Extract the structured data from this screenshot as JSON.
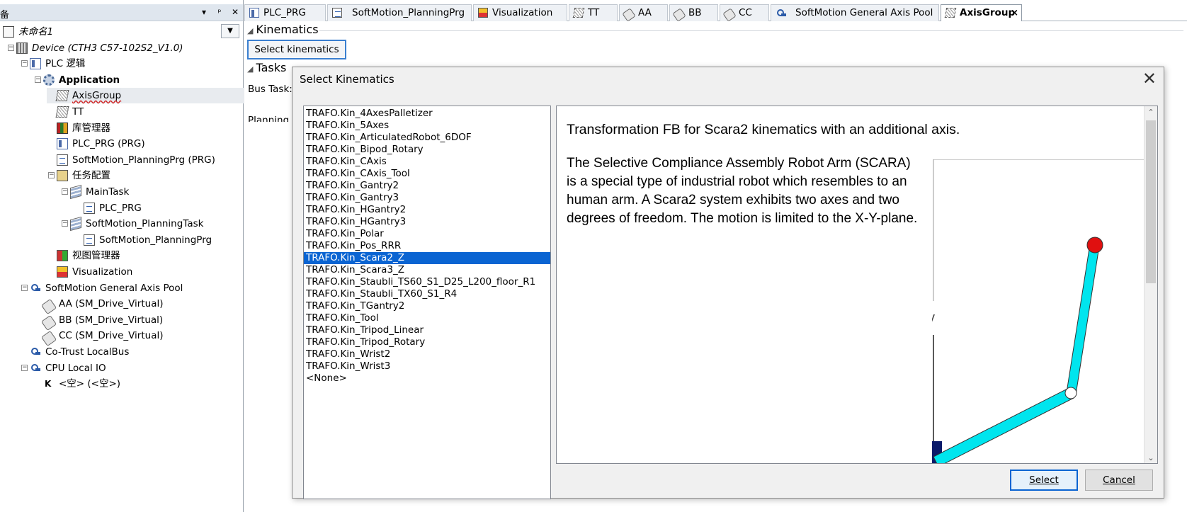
{
  "left_panel": {
    "header_title": "备",
    "header_controls": [
      "▾",
      "ᵖ",
      "✕"
    ],
    "project_selector": "",
    "tree": [
      {
        "label": "未命名1",
        "icon": "project-icon",
        "indent": 0,
        "expander": "",
        "style": "italic"
      },
      {
        "label": "Device (CTH3 C57-102S2_V1.0)",
        "icon": "device-icon",
        "indent": 1,
        "expander": "−",
        "style": "italic"
      },
      {
        "label": "PLC 逻辑",
        "icon": "plc-logic-icon",
        "indent": 2,
        "expander": "−",
        "style": ""
      },
      {
        "label": "Application",
        "icon": "application-gear-icon",
        "indent": 3,
        "expander": "−",
        "style": "bold"
      },
      {
        "label": "AxisGroup",
        "icon": "axis-group-icon",
        "indent": 4,
        "expander": "",
        "style": "squiggle",
        "selected": true
      },
      {
        "label": "TT",
        "icon": "axis-group-icon",
        "indent": 4,
        "expander": "",
        "style": ""
      },
      {
        "label": "库管理器",
        "icon": "library-manager-icon",
        "indent": 4,
        "expander": "",
        "style": ""
      },
      {
        "label": "PLC_PRG (PRG)",
        "icon": "program-icon",
        "indent": 4,
        "expander": "",
        "style": ""
      },
      {
        "label": "SoftMotion_PlanningPrg (PRG)",
        "icon": "program-doc-icon",
        "indent": 4,
        "expander": "",
        "style": ""
      },
      {
        "label": "任务配置",
        "icon": "task-config-icon",
        "indent": 4,
        "expander": "−",
        "style": ""
      },
      {
        "label": "MainTask",
        "icon": "task-icon",
        "indent": 5,
        "expander": "−",
        "style": ""
      },
      {
        "label": "PLC_PRG",
        "icon": "program-call-icon",
        "indent": 6,
        "expander": "",
        "style": ""
      },
      {
        "label": "SoftMotion_PlanningTask",
        "icon": "task-icon",
        "indent": 5,
        "expander": "−",
        "style": ""
      },
      {
        "label": "SoftMotion_PlanningPrg",
        "icon": "program-call-icon",
        "indent": 6,
        "expander": "",
        "style": ""
      },
      {
        "label": "视图管理器",
        "icon": "visualization-manager-icon",
        "indent": 4,
        "expander": "",
        "style": ""
      },
      {
        "label": "Visualization",
        "icon": "visualization-icon",
        "indent": 4,
        "expander": "",
        "style": ""
      },
      {
        "label": "SoftMotion General Axis Pool",
        "icon": "axis-pool-icon",
        "indent": 2,
        "expander": "−",
        "style": ""
      },
      {
        "label": "AA (SM_Drive_Virtual)",
        "icon": "virtual-drive-icon",
        "indent": 3,
        "expander": "",
        "style": ""
      },
      {
        "label": "BB (SM_Drive_Virtual)",
        "icon": "virtual-drive-icon",
        "indent": 3,
        "expander": "",
        "style": ""
      },
      {
        "label": "CC (SM_Drive_Virtual)",
        "icon": "virtual-drive-icon",
        "indent": 3,
        "expander": "",
        "style": ""
      },
      {
        "label": "Co-Trust LocalBus",
        "icon": "bus-icon",
        "indent": 2,
        "expander": "",
        "style": ""
      },
      {
        "label": "CPU Local IO",
        "icon": "bus-icon",
        "indent": 2,
        "expander": "−",
        "style": ""
      },
      {
        "label": "<空> (<空>)",
        "icon": "empty-slot-icon",
        "indent": 3,
        "expander": "",
        "style": ""
      }
    ]
  },
  "tabs": [
    {
      "label": "PLC_PRG",
      "icon": "program-icon",
      "active": false
    },
    {
      "label": "SoftMotion_PlanningPrg",
      "icon": "program-doc-icon",
      "active": false
    },
    {
      "label": "Visualization",
      "icon": "visualization-icon",
      "active": false
    },
    {
      "label": "TT",
      "icon": "axis-group-icon",
      "active": false
    },
    {
      "label": "AA",
      "icon": "virtual-drive-icon",
      "active": false
    },
    {
      "label": "BB",
      "icon": "virtual-drive-icon",
      "active": false
    },
    {
      "label": "CC",
      "icon": "virtual-drive-icon",
      "active": false
    },
    {
      "label": "SoftMotion General Axis Pool",
      "icon": "axis-pool-icon",
      "active": false
    },
    {
      "label": "AxisGroup",
      "icon": "axis-group-icon",
      "active": true,
      "close": "×"
    }
  ],
  "editor": {
    "kinematics_section": "Kinematics",
    "select_kinematics_button": "Select kinematics",
    "tasks_section": "Tasks",
    "bus_task_label": "Bus Task:",
    "planning_task_label": "Planning T"
  },
  "dialog": {
    "title": "Select Kinematics",
    "close": "✕",
    "kinematics_list": [
      "TRAFO.Kin_4AxesPalletizer",
      "TRAFO.Kin_5Axes",
      "TRAFO.Kin_ArticulatedRobot_6DOF",
      "TRAFO.Kin_Bipod_Rotary",
      "TRAFO.Kin_CAxis",
      "TRAFO.Kin_CAxis_Tool",
      "TRAFO.Kin_Gantry2",
      "TRAFO.Kin_Gantry3",
      "TRAFO.Kin_HGantry2",
      "TRAFO.Kin_HGantry3",
      "TRAFO.Kin_Polar",
      "TRAFO.Kin_Pos_RRR",
      "TRAFO.Kin_Scara2_Z",
      "TRAFO.Kin_Scara3_Z",
      "TRAFO.Kin_Staubli_TS60_S1_D25_L200_floor_R1",
      "TRAFO.Kin_Staubli_TX60_S1_R4",
      "TRAFO.Kin_TGantry2",
      "TRAFO.Kin_Tool",
      "TRAFO.Kin_Tripod_Linear",
      "TRAFO.Kin_Tripod_Rotary",
      "TRAFO.Kin_Wrist2",
      "TRAFO.Kin_Wrist3",
      "<None>"
    ],
    "selected_index": 12,
    "description_title": "Transformation FB for Scara2 kinematics with an additional axis.",
    "description_body": "The Selective Compliance Assembly Robot Arm (SCARA) is a special type of industrial robot which resembles to an human arm. A Scara2 system exhibits two axes and two degrees of freedom. The motion is limited to the X-Y-plane.",
    "diagram_axis_label": "y",
    "select_button": "Select",
    "cancel_button": "Cancel",
    "colors": {
      "arm": "#00e5ee",
      "end_effector": "#e01010",
      "selection": "#0a64d2"
    }
  }
}
